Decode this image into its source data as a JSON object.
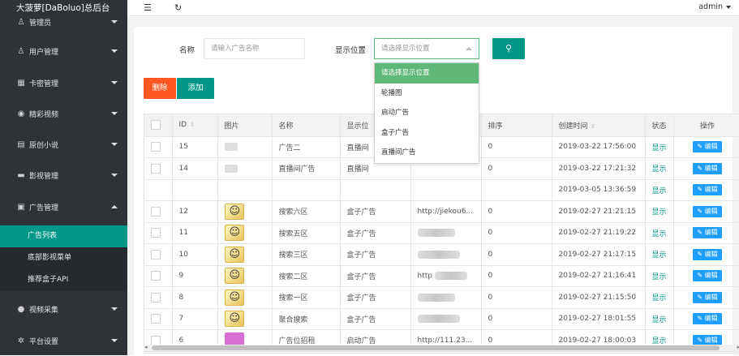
{
  "brand": "大菠萝[DaBoluo]总后台",
  "topbar": {
    "user": "admin"
  },
  "sidebar": {
    "items": [
      {
        "label": "管理员",
        "icon": "admin-icon",
        "glyph": "♙"
      },
      {
        "label": "用户管理",
        "icon": "user-icon",
        "glyph": "♙"
      },
      {
        "label": "卡密管理",
        "icon": "card-icon",
        "glyph": "▦"
      },
      {
        "label": "精彩视频",
        "icon": "play-circle-icon",
        "glyph": "◉"
      },
      {
        "label": "原创小说",
        "icon": "book-icon",
        "glyph": "▤"
      },
      {
        "label": "影视管理",
        "icon": "film-icon",
        "glyph": "▬"
      },
      {
        "label": "广告管理",
        "icon": "ad-icon",
        "glyph": "▣"
      },
      {
        "label": "视频采集",
        "icon": "collect-icon",
        "glyph": "●"
      },
      {
        "label": "平台设置",
        "icon": "settings-icon",
        "glyph": "✲"
      }
    ],
    "sub_items": [
      {
        "label": "广告列表"
      },
      {
        "label": "底部影视菜单"
      },
      {
        "label": "推荐盒子API"
      }
    ]
  },
  "search": {
    "name_label": "名称",
    "name_placeholder": "请输入广告名称",
    "position_label": "显示位置",
    "position_placeholder": "请选择显示位置"
  },
  "actions": {
    "delete": "删除",
    "add": "添加"
  },
  "dropdown": {
    "options": [
      "请选择显示位置",
      "轮播图",
      "启动广告",
      "盒子广告",
      "直播间广告"
    ]
  },
  "table": {
    "headers": [
      "ID",
      "图片",
      "名称",
      "显示位",
      "",
      "排序",
      "创建时间",
      "状态",
      "操作"
    ],
    "rows": [
      {
        "id": "15",
        "thumb": "small",
        "name": "广告二",
        "position": "直播间",
        "link": "",
        "sort": "0",
        "time": "2019-03-22 17:56:00",
        "status": "显示",
        "op": "编辑"
      },
      {
        "id": "14",
        "thumb": "small",
        "name": "直播间广告",
        "position": "直播间",
        "link": "",
        "sort": "0",
        "time": "2019-03-22 17:21:32",
        "status": "显示",
        "op": "编辑"
      },
      {
        "id": "",
        "thumb": "",
        "name": "",
        "position": "",
        "link": "",
        "sort": "",
        "time": "2019-03-05 13:36:59",
        "status": "显示",
        "op": "编辑"
      },
      {
        "id": "12",
        "thumb": "cat",
        "name": "搜索六区",
        "position": "盒子广告",
        "link": "http://jiekou6...",
        "sort": "0",
        "time": "2019-02-27 21:21:15",
        "status": "显示",
        "op": "编辑"
      },
      {
        "id": "11",
        "thumb": "cat",
        "name": "搜索五区",
        "position": "盒子广告",
        "link": "",
        "sort": "0",
        "time": "2019-02-27 21:19:22",
        "status": "显示",
        "op": "编辑"
      },
      {
        "id": "10",
        "thumb": "cat",
        "name": "搜索三区",
        "position": "盒子广告",
        "link": "",
        "sort": "0",
        "time": "2019-02-27 21:17:15",
        "status": "显示",
        "op": "编辑"
      },
      {
        "id": "9",
        "thumb": "cat",
        "name": "搜索二区",
        "position": "盒子广告",
        "link": "http",
        "sort": "0",
        "time": "2019-02-27 21:16:41",
        "status": "显示",
        "op": "编辑"
      },
      {
        "id": "8",
        "thumb": "cat",
        "name": "搜索一区",
        "position": "盒子广告",
        "link": "",
        "sort": "0",
        "time": "2019-02-27 21:15:50",
        "status": "显示",
        "op": "编辑"
      },
      {
        "id": "7",
        "thumb": "cat",
        "name": "聚合搜索",
        "position": "盒子广告",
        "link": "",
        "sort": "0",
        "time": "2019-02-27 18:01:55",
        "status": "显示",
        "op": "编辑"
      },
      {
        "id": "6",
        "thumb": "pink",
        "name": "广告位招租",
        "position": "启动广告",
        "link": "http://111.23...",
        "sort": "0",
        "time": "2019-02-27 18:00:03",
        "status": "显示",
        "op": "编辑"
      }
    ]
  },
  "colors": {
    "accent": "#009688",
    "sidebar_bg": "#2f3237",
    "danger": "#ff5722",
    "edit": "#1e9fff",
    "dropdown_selected": "#5fb878"
  }
}
